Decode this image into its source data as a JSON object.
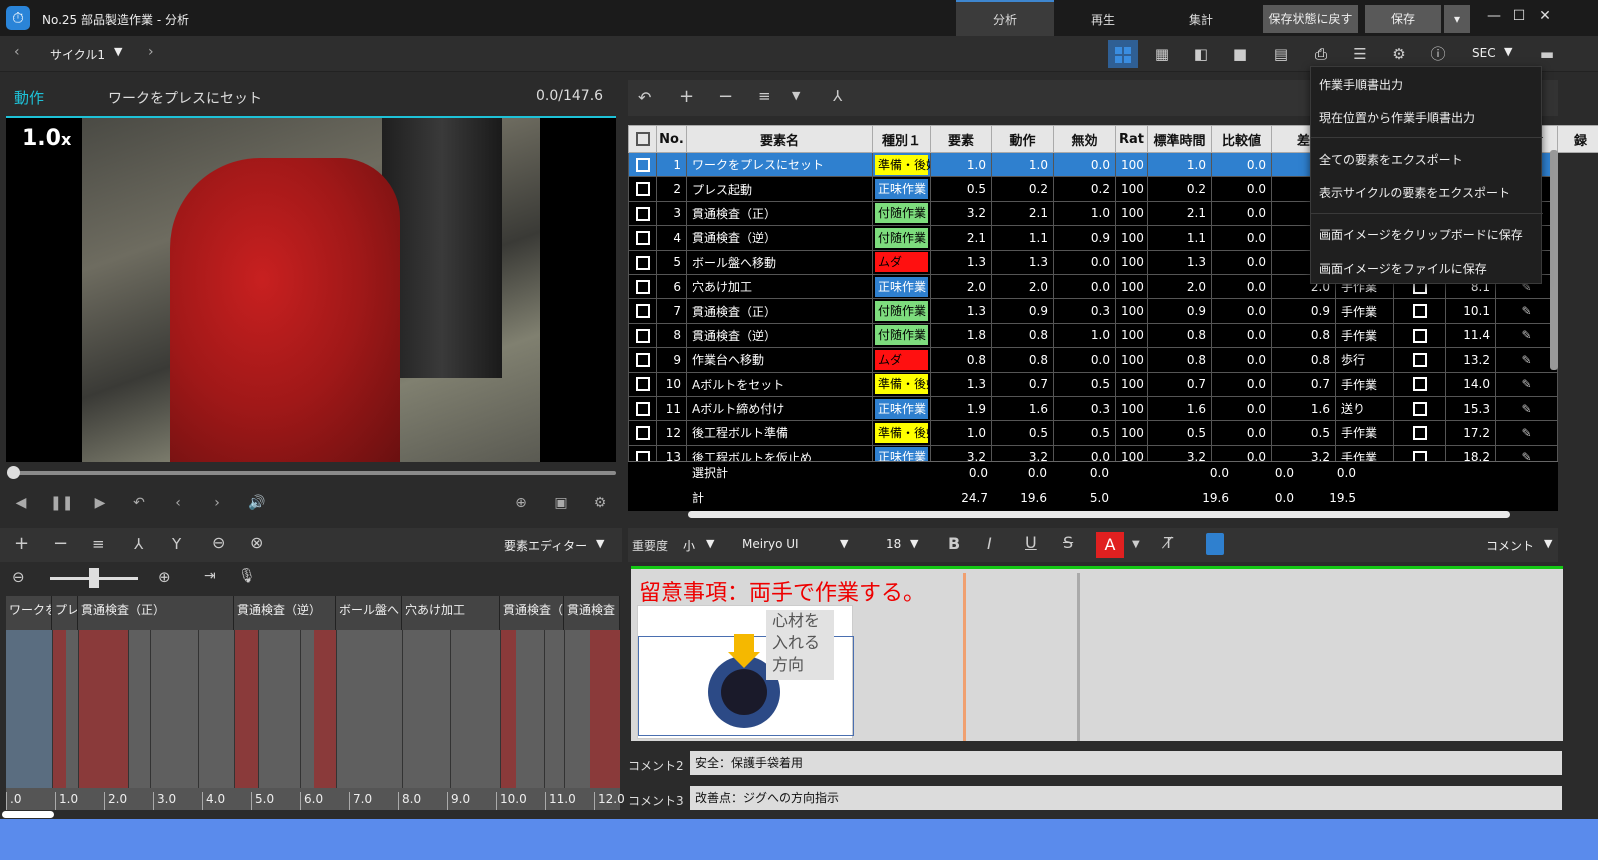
{
  "window": {
    "title": "No.25 部品製造作業 - 分析"
  },
  "main_tabs": [
    {
      "label": "分析"
    },
    {
      "label": "再生"
    },
    {
      "label": "集計"
    }
  ],
  "title_buttons": {
    "revert": "保存状態に戻す",
    "save": "保存"
  },
  "nav": {
    "cycle_label": "サイクル1",
    "unit": "SEC"
  },
  "video": {
    "mode_label": "動作",
    "element_name": "ワークをプレスにセット",
    "time": "0.0/147.6",
    "speed": "1.0",
    "speed_suffix": "x",
    "progress": 0.0
  },
  "table": {
    "columns": [
      "No.",
      "要素名",
      "種別１",
      "要素",
      "動作",
      "無効",
      "Rat",
      "標準時間",
      "比較値",
      "差",
      "",
      "",
      "",
      "録"
    ],
    "rows": [
      {
        "no": "1",
        "name": "ワークをプレスにセット",
        "type": "準備・後始末",
        "type_color": "#ffff00",
        "elem": "1.0",
        "motion": "1.0",
        "invalid": "0.0",
        "rat": "100",
        "std": "1.0",
        "cmp": "0.0",
        "diff": "",
        "kind": "",
        "cum": ""
      },
      {
        "no": "2",
        "name": "プレス起動",
        "type": "正味作業",
        "type_color": "#2f80cf",
        "elem": "0.5",
        "motion": "0.2",
        "invalid": "0.2",
        "rat": "100",
        "std": "0.2",
        "cmp": "0.0",
        "diff": "",
        "kind": "",
        "cum": ""
      },
      {
        "no": "3",
        "name": "貫通検査（正）",
        "type": "付随作業",
        "type_color": "#7ddc7d",
        "elem": "3.2",
        "motion": "2.1",
        "invalid": "1.0",
        "rat": "100",
        "std": "2.1",
        "cmp": "0.0",
        "diff": "",
        "kind": "",
        "cum": ""
      },
      {
        "no": "4",
        "name": "貫通検査（逆）",
        "type": "付随作業",
        "type_color": "#7ddc7d",
        "elem": "2.1",
        "motion": "1.1",
        "invalid": "0.9",
        "rat": "100",
        "std": "1.1",
        "cmp": "0.0",
        "diff": "",
        "kind": "",
        "cum": ""
      },
      {
        "no": "5",
        "name": "ボール盤へ移動",
        "type": "ムダ",
        "type_color": "#ff1010",
        "elem": "1.3",
        "motion": "1.3",
        "invalid": "0.0",
        "rat": "100",
        "std": "1.3",
        "cmp": "0.0",
        "diff": "",
        "kind": "",
        "cum": ""
      },
      {
        "no": "6",
        "name": "穴あけ加工",
        "type": "正味作業",
        "type_color": "#2f80cf",
        "elem": "2.0",
        "motion": "2.0",
        "invalid": "0.0",
        "rat": "100",
        "std": "2.0",
        "cmp": "0.0",
        "diff": "2.0",
        "kind": "手作業",
        "cum": "8.1"
      },
      {
        "no": "7",
        "name": "貫通検査（正）",
        "type": "付随作業",
        "type_color": "#7ddc7d",
        "elem": "1.3",
        "motion": "0.9",
        "invalid": "0.3",
        "rat": "100",
        "std": "0.9",
        "cmp": "0.0",
        "diff": "0.9",
        "kind": "手作業",
        "cum": "10.1"
      },
      {
        "no": "8",
        "name": "貫通検査（逆）",
        "type": "付随作業",
        "type_color": "#7ddc7d",
        "elem": "1.8",
        "motion": "0.8",
        "invalid": "1.0",
        "rat": "100",
        "std": "0.8",
        "cmp": "0.0",
        "diff": "0.8",
        "kind": "手作業",
        "cum": "11.4"
      },
      {
        "no": "9",
        "name": "作業台へ移動",
        "type": "ムダ",
        "type_color": "#ff1010",
        "elem": "0.8",
        "motion": "0.8",
        "invalid": "0.0",
        "rat": "100",
        "std": "0.8",
        "cmp": "0.0",
        "diff": "0.8",
        "kind": "歩行",
        "cum": "13.2"
      },
      {
        "no": "10",
        "name": "Aボルトをセット",
        "type": "準備・後始末",
        "type_color": "#ffff00",
        "elem": "1.3",
        "motion": "0.7",
        "invalid": "0.5",
        "rat": "100",
        "std": "0.7",
        "cmp": "0.0",
        "diff": "0.7",
        "kind": "手作業",
        "cum": "14.0"
      },
      {
        "no": "11",
        "name": "Aボルト締め付け",
        "type": "正味作業",
        "type_color": "#2f80cf",
        "elem": "1.9",
        "motion": "1.6",
        "invalid": "0.3",
        "rat": "100",
        "std": "1.6",
        "cmp": "0.0",
        "diff": "1.6",
        "kind": "送り",
        "cum": "15.3"
      },
      {
        "no": "12",
        "name": "後工程ボルト準備",
        "type": "準備・後始末",
        "type_color": "#ffff00",
        "elem": "1.0",
        "motion": "0.5",
        "invalid": "0.5",
        "rat": "100",
        "std": "0.5",
        "cmp": "0.0",
        "diff": "0.5",
        "kind": "手作業",
        "cum": "17.2"
      },
      {
        "no": "13",
        "name": "後工程ボルトを仮止め",
        "type": "正味作業",
        "type_color": "#2f80cf",
        "elem": "3.2",
        "motion": "3.2",
        "invalid": "0.0",
        "rat": "100",
        "std": "3.2",
        "cmp": "0.0",
        "diff": "3.2",
        "kind": "手作業",
        "cum": "18.2"
      }
    ],
    "totals": {
      "selected_label": "選択計",
      "selected": [
        "0.0",
        "0.0",
        "0.0",
        "0.0",
        "0.0",
        "0.0"
      ],
      "total_label": "計",
      "total": [
        "24.7",
        "19.6",
        "5.0",
        "19.6",
        "0.0",
        "19.5"
      ]
    }
  },
  "menu": {
    "items": [
      "作業手順書出力",
      "現在位置から作業手順書出力",
      "全ての要素をエクスポート",
      "表示サイクルの要素をエクスポート",
      "画面イメージをクリップボードに保存",
      "画面イメージをファイルに保存"
    ]
  },
  "editor": {
    "title": "要素エディター",
    "timeline_labels": [
      "ワークを",
      "プレ",
      "貫通検査（正）",
      "貫通検査（逆）",
      "ボール盤へ",
      "穴あけ加工",
      "貫通検査（",
      "貫通検査"
    ],
    "ruler": [
      ".0",
      "1.0",
      "2.0",
      "3.0",
      "4.0",
      "5.0",
      "6.0",
      "7.0",
      "8.0",
      "9.0",
      "10.0",
      "11.0",
      "12.0"
    ]
  },
  "comment_toolbar": {
    "importance_label": "重要度",
    "importance_value": "小",
    "font_name": "Meiryo UI",
    "font_size": "18",
    "view_label": "コメント"
  },
  "note": {
    "text": "留意事項：両手で作業する。",
    "image_caption": "心材を入れる方向",
    "image_caption_lines": [
      "心材を",
      "入れる",
      "方向"
    ]
  },
  "comments": [
    {
      "label": "コメント2",
      "value": "安全：保護手袋着用"
    },
    {
      "label": "コメント3",
      "value": "改善点：ジグへの方向指示"
    }
  ],
  "colors": {
    "accent": "#2f80cf",
    "note_border": "#14c814",
    "status_bar": "#5a8bec",
    "video_border": "#1ec2d8"
  }
}
